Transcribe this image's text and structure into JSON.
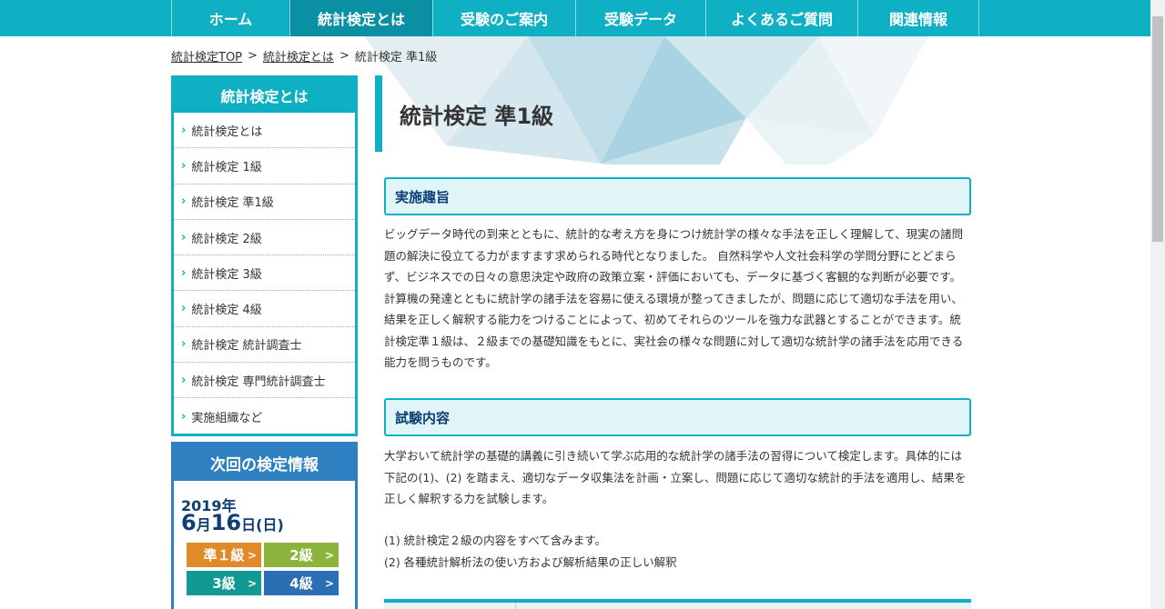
{
  "nav": {
    "items": [
      {
        "label": "ホーム",
        "active": false
      },
      {
        "label": "統計検定とは",
        "active": true
      },
      {
        "label": "受験のご案内",
        "active": false
      },
      {
        "label": "受験データ",
        "active": false
      },
      {
        "label": "よくあるご質問",
        "active": false
      },
      {
        "label": "関連情報",
        "active": false
      }
    ]
  },
  "breadcrumb": {
    "items": [
      "統計検定TOP",
      "統計検定とは",
      "統計検定 準1級"
    ],
    "separator": ">"
  },
  "sidebar": {
    "title": "統計検定とは",
    "items": [
      "統計検定とは",
      "統計検定 1級",
      "統計検定 準1級",
      "統計検定 2級",
      "統計検定 3級",
      "統計検定 4級",
      "統計検定 統計調査士",
      "統計検定 専門統計調査士",
      "実施組織など"
    ]
  },
  "next_exam": {
    "title": "次回の検定情報",
    "year": "2019年",
    "month": "6",
    "month_unit": "月",
    "day": "16",
    "day_unit": "日(日)",
    "buttons": [
      {
        "label": "準１級",
        "color": "#e08a2a"
      },
      {
        "label": "2級",
        "color": "#8cb43c"
      },
      {
        "label": "3級",
        "color": "#109a93"
      },
      {
        "label": "4級",
        "color": "#2a6eb4"
      }
    ]
  },
  "main": {
    "title": "統計検定 準1級",
    "sections": [
      {
        "heading": "実施趣旨",
        "body": "ビッグデータ時代の到来とともに、統計的な考え方を身につけ統計学の様々な手法を正しく理解して、現実の諸問題の解決に役立てる力がますます求められる時代となりました。 自然科学や人文社会科学の学問分野にとどまらず、ビジネスでの日々の意思決定や政府の政策立案・評価においても、データに基づく客観的な判断が必要です。計算機の発達とともに統計学の諸手法を容易に使える環境が整ってきましたが、問題に応じて適切な手法を用い、結果を正しく解釈する能力をつけることによって、初めてそれらのツールを強力な武器とすることができます。統計検定準１級は、２級までの基礎知識をもとに、実社会の様々な問題に対して適切な統計学の諸手法を応用できる能力を問うものです。"
      },
      {
        "heading": "試験内容",
        "body": "大学おいて統計学の基礎的講義に引き続いて学ぶ応用的な統計学の諸手法の習得について検定します。具体的には下記の(1)、(2) を踏まえ、適切なデータ収集法を計画・立案し、問題に応じて適切な統計的手法を適用し、結果を正しく解釈する力を試験します。",
        "list": [
          "(1) 統計検定２級の内容をすべて含みます。",
          "(2) 各種統計解析法の使い方および解析結果の正しい解釈"
        ]
      }
    ]
  },
  "colors": {
    "accent": "#0fb0c4",
    "nav_active": "#0a8fa3",
    "next_exam": "#2f80c0",
    "heading_text": "#0d3e74"
  }
}
